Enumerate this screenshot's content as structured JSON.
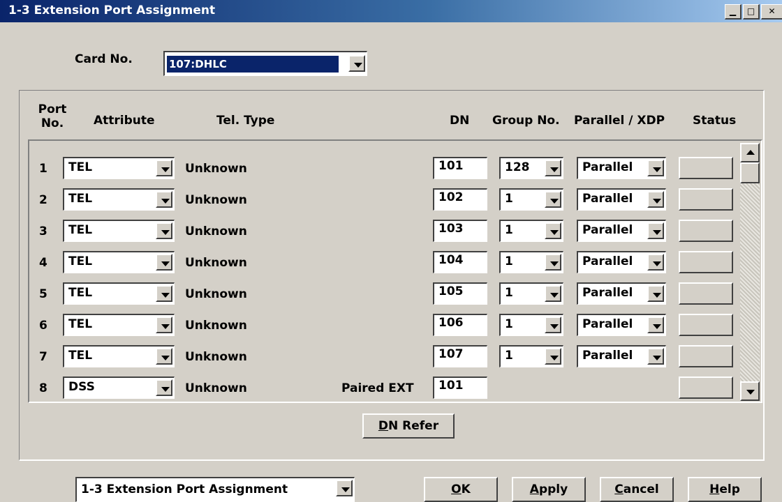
{
  "window": {
    "title": "1-3 Extension Port Assignment"
  },
  "card": {
    "label": "Card No.",
    "value": "107:DHLC"
  },
  "headers": {
    "port_no_line1": "Port",
    "port_no_line2": "No.",
    "attribute": "Attribute",
    "tel_type": "Tel. Type",
    "dn": "DN",
    "group_no": "Group No.",
    "parallel_xdp": "Parallel / XDP",
    "status": "Status"
  },
  "rows": [
    {
      "port": "1",
      "attribute": "TEL",
      "tel_type": "Unknown",
      "extra_label": "",
      "dn": "101",
      "group": "128",
      "parallel": "Parallel"
    },
    {
      "port": "2",
      "attribute": "TEL",
      "tel_type": "Unknown",
      "extra_label": "",
      "dn": "102",
      "group": "1",
      "parallel": "Parallel"
    },
    {
      "port": "3",
      "attribute": "TEL",
      "tel_type": "Unknown",
      "extra_label": "",
      "dn": "103",
      "group": "1",
      "parallel": "Parallel"
    },
    {
      "port": "4",
      "attribute": "TEL",
      "tel_type": "Unknown",
      "extra_label": "",
      "dn": "104",
      "group": "1",
      "parallel": "Parallel"
    },
    {
      "port": "5",
      "attribute": "TEL",
      "tel_type": "Unknown",
      "extra_label": "",
      "dn": "105",
      "group": "1",
      "parallel": "Parallel"
    },
    {
      "port": "6",
      "attribute": "TEL",
      "tel_type": "Unknown",
      "extra_label": "",
      "dn": "106",
      "group": "1",
      "parallel": "Parallel"
    },
    {
      "port": "7",
      "attribute": "TEL",
      "tel_type": "Unknown",
      "extra_label": "",
      "dn": "107",
      "group": "1",
      "parallel": "Parallel"
    },
    {
      "port": "8",
      "attribute": "DSS",
      "tel_type": "Unknown",
      "extra_label": "Paired EXT",
      "dn": "101",
      "group": null,
      "parallel": null
    }
  ],
  "dn_refer": {
    "key": "D",
    "rest": "N Refer"
  },
  "footer": {
    "screen_select": "1-3 Extension Port Assignment",
    "ok": {
      "key": "O",
      "rest": "K"
    },
    "apply": {
      "key": "A",
      "rest": "pply"
    },
    "cancel": {
      "key": "C",
      "rest": "ancel"
    },
    "help": {
      "key": "H",
      "rest": "elp"
    }
  },
  "colors": {
    "face": "#d4d0c8",
    "title_start": "#0a246a",
    "title_end": "#a6caf0",
    "selection": "#0a246a"
  }
}
